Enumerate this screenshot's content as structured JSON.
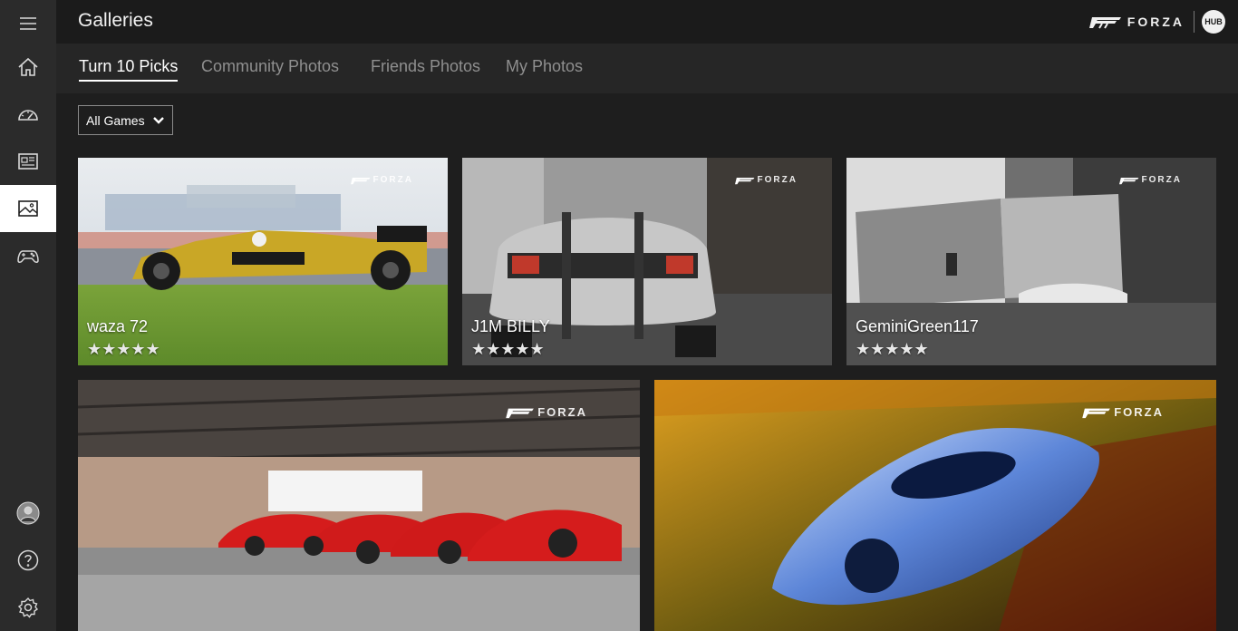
{
  "app": {
    "title": "Galleries"
  },
  "brand": {
    "name": "FORZA",
    "hub": "HUB"
  },
  "tabs": [
    {
      "label": "Turn 10 Picks",
      "active": true
    },
    {
      "label": "Community Photos",
      "active": false
    },
    {
      "label": "Friends Photos",
      "active": false
    },
    {
      "label": "My Photos",
      "active": false
    }
  ],
  "filter": {
    "selected": "All Games"
  },
  "sidebar": {
    "items": [
      {
        "icon": "hamburger-menu-icon"
      },
      {
        "icon": "home-icon"
      },
      {
        "icon": "speedometer-icon"
      },
      {
        "icon": "news-icon"
      },
      {
        "icon": "gallery-icon",
        "active": true
      },
      {
        "icon": "controller-icon"
      }
    ],
    "bottom": [
      {
        "icon": "avatar-icon"
      },
      {
        "icon": "help-icon"
      },
      {
        "icon": "settings-icon"
      }
    ]
  },
  "photos": [
    {
      "author": "waza 72",
      "stars": "★★★★★",
      "watermark": "FORZA"
    },
    {
      "author": "J1M BILLY",
      "stars": "★★★★★",
      "watermark": "FORZA"
    },
    {
      "author": "GeminiGreen117",
      "stars": "★★★★★",
      "watermark": "FORZA"
    },
    {
      "author": "",
      "stars": "",
      "watermark": "FORZA"
    },
    {
      "author": "",
      "stars": "",
      "watermark": "FORZA"
    }
  ]
}
